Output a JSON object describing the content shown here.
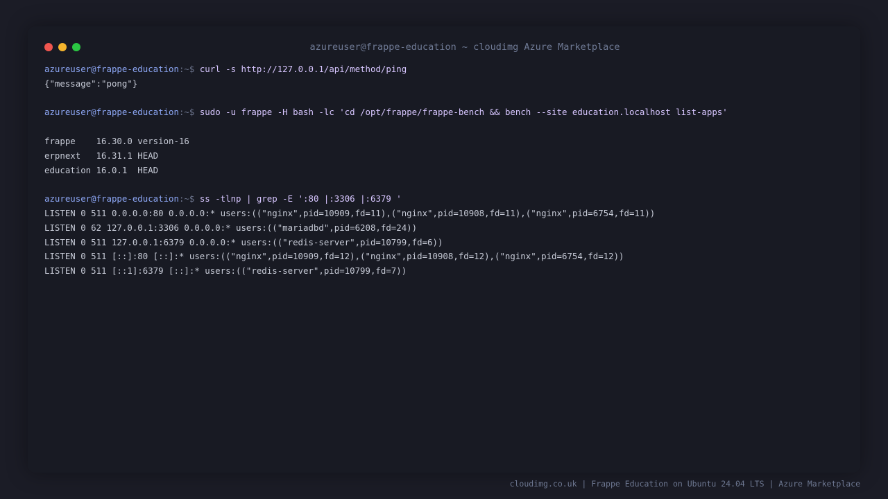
{
  "window": {
    "title": "azureuser@frappe-education ~ cloudimg Azure Marketplace"
  },
  "prompt": {
    "user_host": "azureuser@frappe-education",
    "path": ":~$"
  },
  "terminal": {
    "blocks": [
      {
        "command": "curl -s http://127.0.0.1/api/method/ping",
        "output": [
          "{\"message\":\"pong\"}"
        ]
      },
      {
        "command": "sudo -u frappe -H bash -lc 'cd /opt/frappe/frappe-bench && bench --site education.localhost list-apps'",
        "output": [
          "",
          "frappe    16.30.0 version-16",
          "erpnext   16.31.1 HEAD",
          "education 16.0.1  HEAD"
        ]
      },
      {
        "command": "ss -tlnp | grep -E ':80 |:3306 |:6379 '",
        "output": [
          "LISTEN 0 511 0.0.0.0:80 0.0.0.0:* users:((\"nginx\",pid=10909,fd=11),(\"nginx\",pid=10908,fd=11),(\"nginx\",pid=6754,fd=11))",
          "LISTEN 0 62 127.0.0.1:3306 0.0.0.0:* users:((\"mariadbd\",pid=6208,fd=24))",
          "LISTEN 0 511 127.0.0.1:6379 0.0.0.0:* users:((\"redis-server\",pid=10799,fd=6))",
          "LISTEN 0 511 [::]:80 [::]:* users:((\"nginx\",pid=10909,fd=12),(\"nginx\",pid=10908,fd=12),(\"nginx\",pid=6754,fd=12))",
          "LISTEN 0 511 [::1]:6379 [::]:* users:((\"redis-server\",pid=10799,fd=7))"
        ]
      }
    ]
  },
  "footer": {
    "text": "cloudimg.co.uk | Frappe Education on Ubuntu 24.04 LTS | Azure Marketplace"
  },
  "colors": {
    "background": "#1b1c26",
    "window": "#181a23",
    "prompt_user": "#8da7f5",
    "command": "#d7c6ff",
    "output": "#c6cad6"
  }
}
